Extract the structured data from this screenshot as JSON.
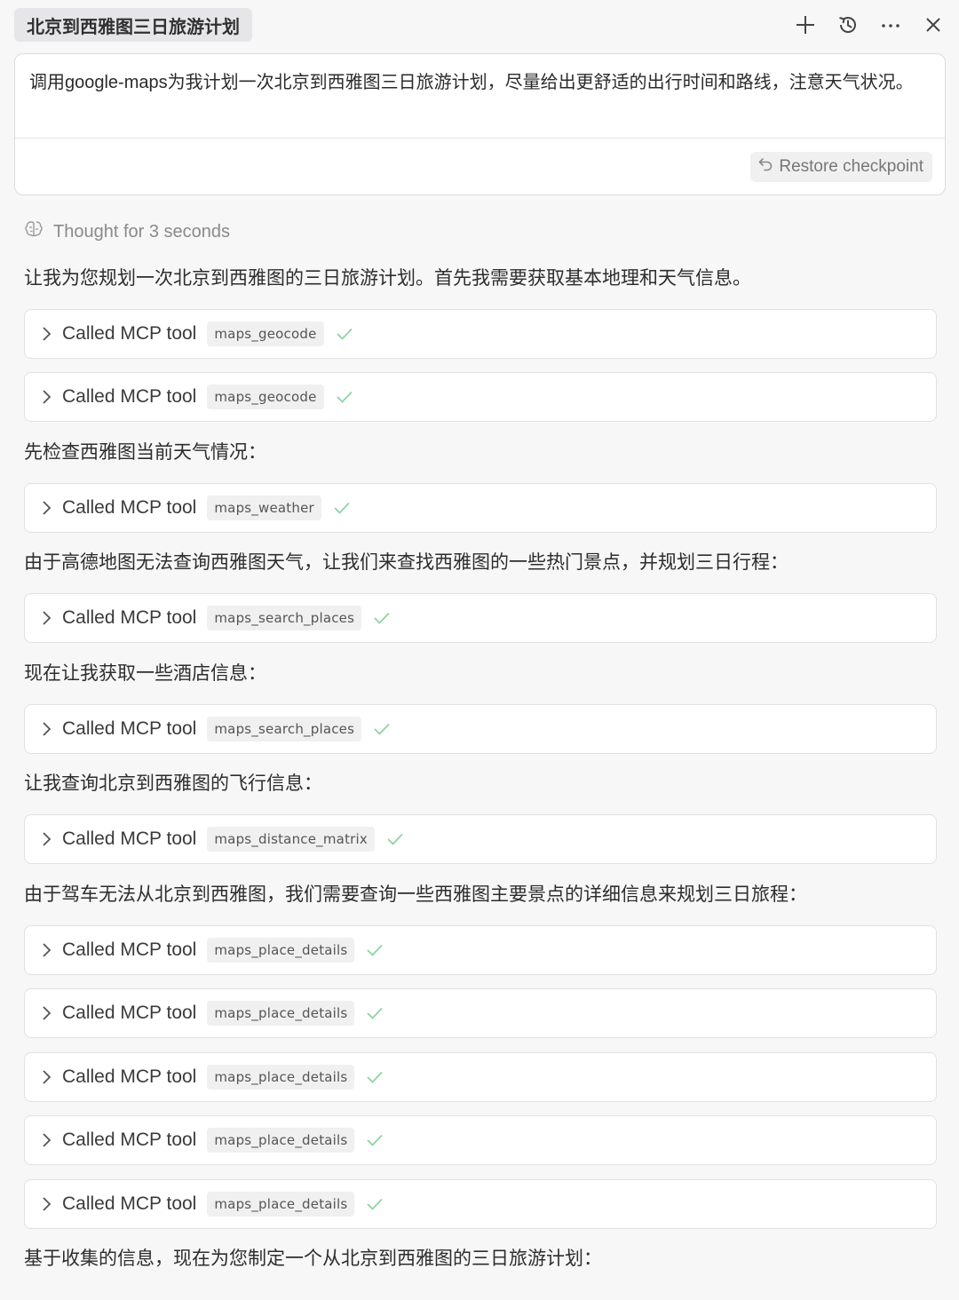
{
  "header": {
    "title": "北京到西雅图三日旅游计划"
  },
  "prompt": {
    "text": "调用google-maps为我计划一次北京到西雅图三日旅游计划，尽量给出更舒适的出行时间和路线，注意天气状况。",
    "restore_label": "Restore checkpoint"
  },
  "thought": {
    "label": "Thought for 3 seconds"
  },
  "messages": [
    "让我为您规划一次北京到西雅图的三日旅游计划。首先我需要获取基本地理和天气信息。",
    "先检查西雅图当前天气情况：",
    "由于高德地图无法查询西雅图天气，让我们来查找西雅图的一些热门景点，并规划三日行程：",
    "现在让我获取一些酒店信息：",
    "让我查询北京到西雅图的飞行信息：",
    "由于驾车无法从北京到西雅图，我们需要查询一些西雅图主要景点的详细信息来规划三日旅程：",
    "基于收集的信息，现在为您制定一个从北京到西雅图的三日旅游计划："
  ],
  "tool_calls": [
    {
      "label": "Called MCP tool",
      "tool": "maps_geocode"
    },
    {
      "label": "Called MCP tool",
      "tool": "maps_geocode"
    },
    {
      "label": "Called MCP tool",
      "tool": "maps_weather"
    },
    {
      "label": "Called MCP tool",
      "tool": "maps_search_places"
    },
    {
      "label": "Called MCP tool",
      "tool": "maps_search_places"
    },
    {
      "label": "Called MCP tool",
      "tool": "maps_distance_matrix"
    },
    {
      "label": "Called MCP tool",
      "tool": "maps_place_details"
    },
    {
      "label": "Called MCP tool",
      "tool": "maps_place_details"
    },
    {
      "label": "Called MCP tool",
      "tool": "maps_place_details"
    },
    {
      "label": "Called MCP tool",
      "tool": "maps_place_details"
    },
    {
      "label": "Called MCP tool",
      "tool": "maps_place_details"
    }
  ],
  "colors": {
    "check": "#8fd3a6",
    "background": "#f7f7f7"
  },
  "icons": {
    "new_chat": "plus-icon",
    "history": "history-icon",
    "more": "more-icon",
    "close": "close-icon",
    "restore": "undo-icon",
    "thought": "brain-icon",
    "expand": "chevron-right-icon",
    "done": "check-icon"
  }
}
